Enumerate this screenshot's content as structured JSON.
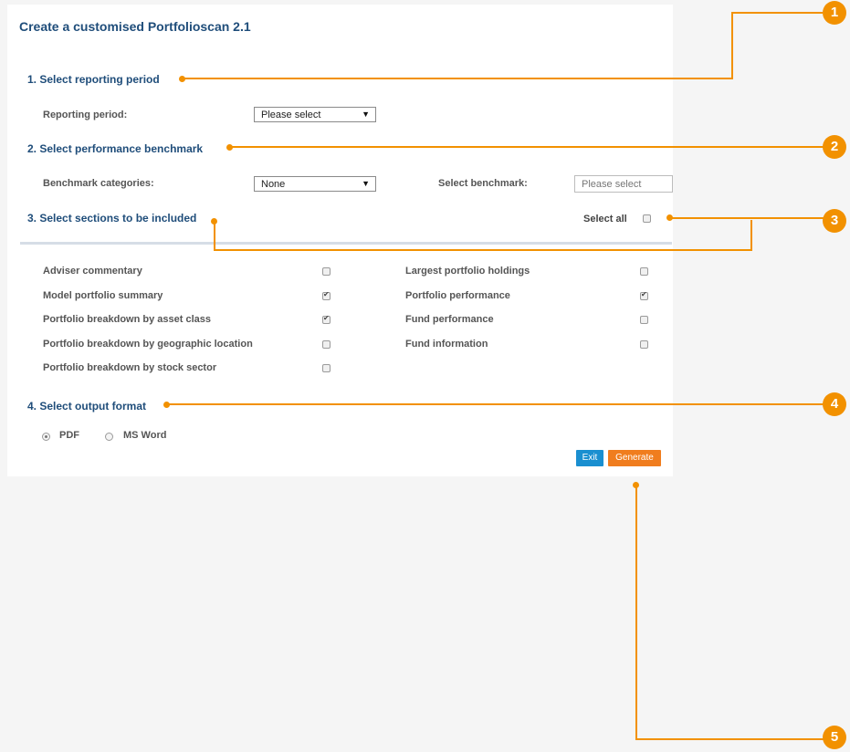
{
  "form": {
    "title": "Create a customised Portfolioscan 2.1",
    "sections": {
      "reporting": {
        "heading": "1. Select reporting period",
        "period_label": "Reporting period:",
        "period_value": "Please select"
      },
      "benchmark": {
        "heading": "2. Select performance benchmark",
        "categories_label": "Benchmark categories:",
        "categories_value": "None",
        "benchmark_label": "Select benchmark:",
        "benchmark_value": "Please select"
      },
      "included": {
        "heading": "3. Select sections to be included",
        "select_all_label": "Select all",
        "select_all_checked": false,
        "items": [
          {
            "label": "Adviser commentary",
            "checked": false
          },
          {
            "label": "Model portfolio summary",
            "checked": true
          },
          {
            "label": "Portfolio breakdown by asset class",
            "checked": true
          },
          {
            "label": "Portfolio breakdown by geographic location",
            "checked": false
          },
          {
            "label": "Portfolio breakdown by stock sector",
            "checked": false
          },
          {
            "label": "Largest portfolio holdings",
            "checked": false
          },
          {
            "label": "Portfolio performance",
            "checked": true
          },
          {
            "label": "Fund performance",
            "checked": false
          },
          {
            "label": "Fund information",
            "checked": false
          }
        ]
      },
      "output": {
        "heading": "4. Select output format",
        "options": [
          "PDF",
          "MS Word"
        ],
        "selected": "PDF"
      }
    },
    "buttons": {
      "exit": "Exit",
      "generate": "Generate"
    }
  },
  "callouts": [
    "1",
    "2",
    "3",
    "4",
    "5"
  ],
  "colors": {
    "accent": "#f29100",
    "heading": "#1f4d7a",
    "exit_button": "#1a8fd0",
    "generate_button": "#f07d1e"
  }
}
